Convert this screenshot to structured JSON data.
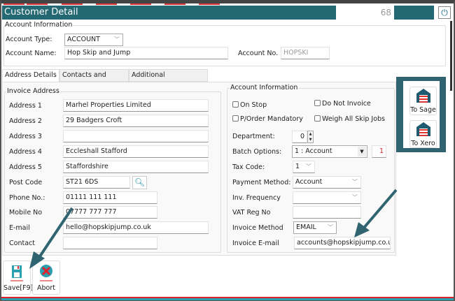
{
  "window": {
    "title": "Customer Detail",
    "record_number": "68"
  },
  "account_info": {
    "group_label": "Account Information",
    "account_type_label": "Account Type:",
    "account_type_value": "ACCOUNT",
    "account_name_label": "Account Name:",
    "account_name_value": "Hop Skip and Jump",
    "account_no_label": "Account No.",
    "account_no_value": "HOPSKI"
  },
  "tabs": [
    {
      "label": "Address Details",
      "active": true
    },
    {
      "label": "Contacts and Notes"
    },
    {
      "label": "Additional Information"
    }
  ],
  "invoice_address": {
    "group_label": "Invoice Address",
    "rows": [
      {
        "label": "Address 1",
        "value": "Marhel Properties Limited"
      },
      {
        "label": "Address 2",
        "value": "29 Badgers Croft"
      },
      {
        "label": "Address 3",
        "value": ""
      },
      {
        "label": "Address 4",
        "value": "Eccleshall Stafford"
      },
      {
        "label": "Address 5",
        "value": "Staffordshire"
      },
      {
        "label": "Post Code",
        "value": "ST21 6DS"
      },
      {
        "label": "Phone No.:",
        "value": "01111 111 111"
      },
      {
        "label": "Mobile No",
        "value": "07777 777 777"
      },
      {
        "label": "E-mail",
        "value": "hello@hopskipjump.co.uk"
      },
      {
        "label": "Contact",
        "value": ""
      }
    ]
  },
  "account_settings": {
    "group_label": "Account Information",
    "on_stop": "On Stop",
    "do_not_invoice": "Do Not Invoice",
    "po_mandatory": "P/Order Mandatory",
    "weigh_all": "Weigh All Skip Jobs",
    "department_label": "Department:",
    "department_value": "0",
    "batch_label": "Batch Options:",
    "batch_value": "1 : Account",
    "batch_number": "1",
    "tax_label": "Tax Code:",
    "tax_value": "1",
    "payment_label": "Payment Method:",
    "payment_value": "Account",
    "freq_label": "Inv. Frequency",
    "freq_value": "",
    "vat_label": "VAT Reg No",
    "vat_value": "",
    "inv_method_label": "Invoice Method",
    "inv_method_value": "EMAIL",
    "inv_email_label": "Invoice E-mail",
    "inv_email_value": "accounts@hopskipjump.co.uk"
  },
  "export": {
    "sage_label": "To Sage",
    "xero_label": "To Xero"
  },
  "footer": {
    "save_label": "Save[F9]",
    "abort_label": "Abort"
  },
  "colors": {
    "teal": "#236873",
    "accent_red": "#e0202a",
    "annotation_arrow": "#2f6470"
  }
}
